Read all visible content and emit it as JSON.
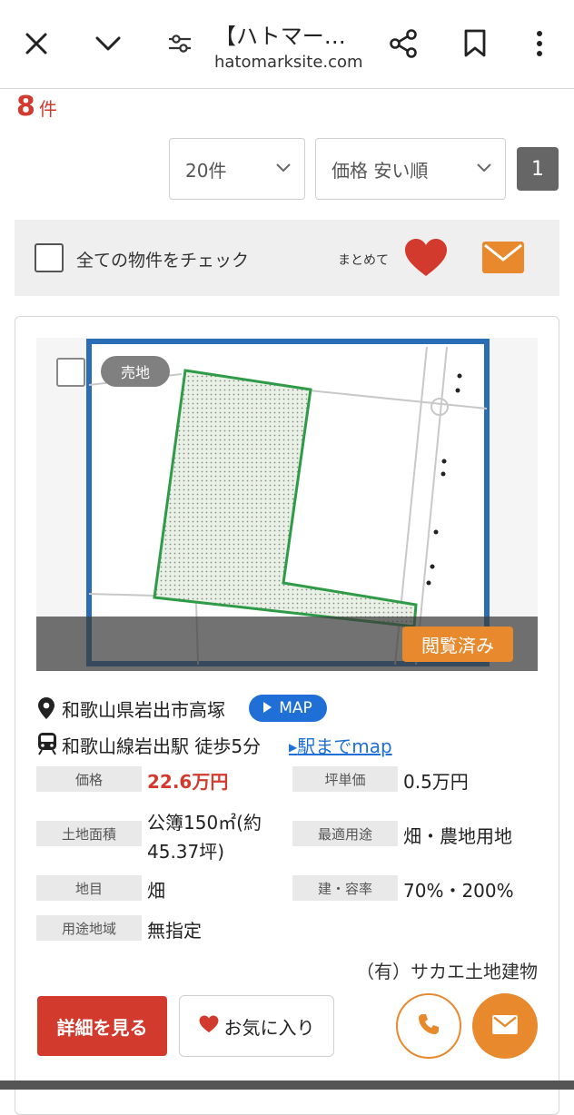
{
  "browser": {
    "title": "【ハトマー…",
    "url": "hatomarksite.com"
  },
  "results": {
    "count": "8",
    "unit": "件"
  },
  "controls": {
    "per_page": "20件",
    "sort": "価格 安い順",
    "page": "1"
  },
  "bulk": {
    "check_all_label": "全ての物件をチェック",
    "matome_label": "まとめて"
  },
  "listing": {
    "badge": "売地",
    "viewed": "閲覧済み",
    "location": "和歌山県岩出市高塚",
    "map_button": "MAP",
    "station": "和歌山線岩出駅 徒歩5分",
    "station_map_link": "駅までmap",
    "rows": [
      {
        "label": "価格",
        "value": "22.6万円"
      },
      {
        "label": "坪単価",
        "value": "0.5万円"
      },
      {
        "label": "土地面積",
        "value": "公簿150㎡(約",
        "value2": "45.37坪)"
      },
      {
        "label": "最適用途",
        "value": "畑・農地用地"
      },
      {
        "label": "地目",
        "value": "畑"
      },
      {
        "label": "建・容率",
        "value": "70%・200%"
      },
      {
        "label": "用途地域",
        "value": "無指定"
      }
    ],
    "company": "（有）サカエ土地建物",
    "detail_button": "詳細を見る",
    "favorite_button": "お気に入り"
  },
  "colors": {
    "accent_red": "#d23a2e",
    "accent_orange": "#e8892e",
    "link_blue": "#1f6fd6"
  }
}
